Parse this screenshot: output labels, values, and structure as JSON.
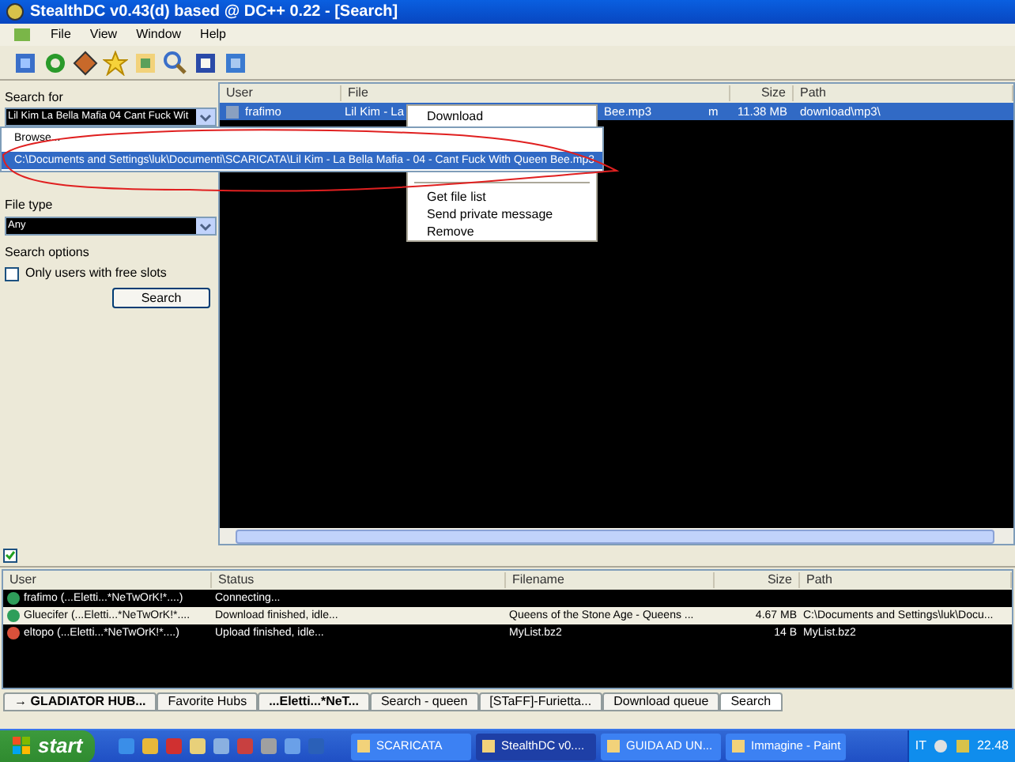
{
  "window": {
    "title": "StealthDC v0.43(d) based @ DC++  0.22 - [Search]"
  },
  "menu": [
    "File",
    "View",
    "Window",
    "Help"
  ],
  "search_panel": {
    "search_for_label": "Search for",
    "search_value": "Lil Kim La Bella Mafia 04 Cant Fuck Wit",
    "dropdown_items": [
      {
        "label": "Browse...",
        "selected": false
      },
      {
        "label": "C:\\Documents and Settings\\luk\\Documenti\\SCARICATA\\Lil Kim - La Bella Mafia - 04 - Cant Fuck With Queen Bee.mp3",
        "selected": true
      }
    ],
    "file_type_label": "File type",
    "file_type_value": "Any",
    "options_label": "Search options",
    "free_slots": {
      "label": "Only users with free slots",
      "checked": false
    },
    "search_button": "Search"
  },
  "results": {
    "columns": [
      "User",
      "File",
      "Size",
      "Path"
    ],
    "rows": [
      {
        "user": "frafimo",
        "file": "Lil Kim - La",
        "file_end": "Bee.mp3",
        "column_3": "m",
        "size": "11.38 MB",
        "path": "download\\mp3\\",
        "selected": true
      }
    ]
  },
  "context_menu": [
    "Download",
    "Get file list",
    "Send private message",
    "Remove"
  ],
  "transfers": {
    "toggle_checked": true,
    "columns": [
      "User",
      "Status",
      "Filename",
      "Size",
      "Path"
    ],
    "rows": [
      {
        "user": "frafimo (...Eletti...*NeTwOrK!*....)",
        "status": "Connecting...",
        "filename": "",
        "size": "",
        "path": "",
        "selected": false
      },
      {
        "user": "Gluecifer (...Eletti...*NeTwOrK!*....",
        "status": "Download finished, idle...",
        "filename": "Queens of the Stone Age - Queens ...",
        "size": "4.67 MB",
        "path": "C:\\Documents and Settings\\luk\\Docu...",
        "selected": true
      },
      {
        "user": "eltopo (...Eletti...*NeTwOrK!*....)",
        "status": "Upload finished, idle...",
        "filename": "MyList.bz2",
        "size": "14 B",
        "path": "MyList.bz2",
        "selected": false
      }
    ]
  },
  "tabs": [
    {
      "label": "→ GLADIATOR HUB...",
      "bold": true,
      "selected": false
    },
    {
      "label": "Favorite Hubs",
      "bold": false,
      "selected": false
    },
    {
      "label": "...Eletti...*NeT...",
      "bold": true,
      "selected": false
    },
    {
      "label": "Search - queen",
      "bold": false,
      "selected": false
    },
    {
      "label": "[STaFF]-Furietta...",
      "bold": false,
      "selected": false
    },
    {
      "label": "Download queue",
      "bold": false,
      "selected": false
    },
    {
      "label": "Search",
      "bold": false,
      "selected": true
    }
  ],
  "taskbar": {
    "start": "start",
    "tasks": [
      {
        "label": "SCARICATA",
        "selected": false
      },
      {
        "label": "StealthDC v0....",
        "selected": true
      },
      {
        "label": "GUIDA AD UN...",
        "selected": false
      },
      {
        "label": "Immagine - Paint",
        "selected": false
      }
    ],
    "language": "IT",
    "clock": "22.48"
  }
}
